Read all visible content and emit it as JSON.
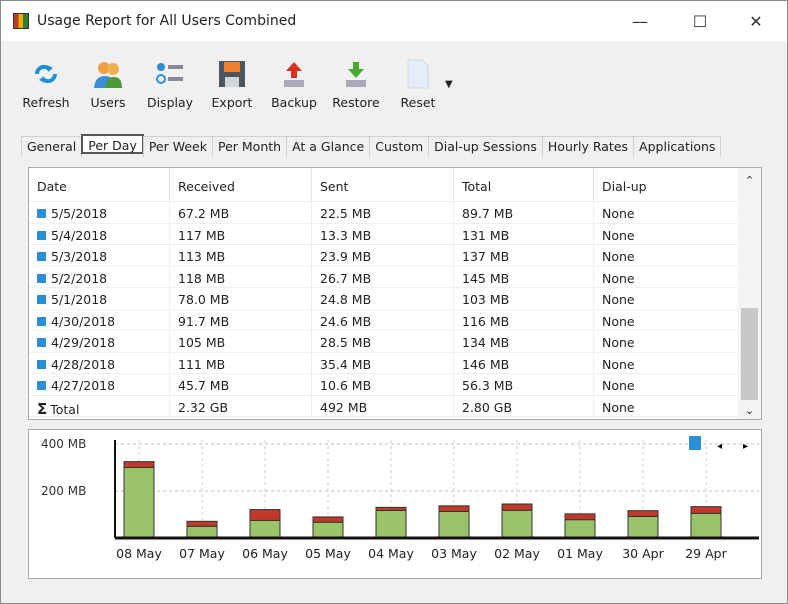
{
  "window": {
    "title": "Usage Report for All Users Combined"
  },
  "toolbar": [
    {
      "label": "Refresh",
      "icon": "refresh-icon"
    },
    {
      "label": "Users",
      "icon": "users-icon"
    },
    {
      "label": "Display",
      "icon": "display-icon"
    },
    {
      "label": "Export",
      "icon": "save-icon"
    },
    {
      "label": "Backup",
      "icon": "backup-icon"
    },
    {
      "label": "Restore",
      "icon": "restore-icon"
    },
    {
      "label": "Reset",
      "icon": "reset-icon"
    }
  ],
  "tabs": [
    "General",
    "Per Day",
    "Per Week",
    "Per Month",
    "At a Glance",
    "Custom",
    "Dial-up Sessions",
    "Hourly Rates",
    "Applications"
  ],
  "active_tab": "Per Day",
  "table": {
    "columns": [
      "Date",
      "Received",
      "Sent",
      "Total",
      "Dial-up"
    ],
    "rows": [
      [
        "5/5/2018",
        "67.2 MB",
        "22.5 MB",
        "89.7 MB",
        "None"
      ],
      [
        "5/4/2018",
        "117 MB",
        "13.3 MB",
        "131 MB",
        "None"
      ],
      [
        "5/3/2018",
        "113 MB",
        "23.9 MB",
        "137 MB",
        "None"
      ],
      [
        "5/2/2018",
        "118 MB",
        "26.7 MB",
        "145 MB",
        "None"
      ],
      [
        "5/1/2018",
        "78.0 MB",
        "24.8 MB",
        "103 MB",
        "None"
      ],
      [
        "4/30/2018",
        "91.7 MB",
        "24.6 MB",
        "116 MB",
        "None"
      ],
      [
        "4/29/2018",
        "105 MB",
        "28.5 MB",
        "134 MB",
        "None"
      ],
      [
        "4/28/2018",
        "111 MB",
        "35.4 MB",
        "146 MB",
        "None"
      ],
      [
        "4/27/2018",
        "45.7 MB",
        "10.6 MB",
        "56.3 MB",
        "None"
      ]
    ],
    "total": [
      "Total",
      "2.32 GB",
      "492 MB",
      "2.80 GB",
      "None"
    ]
  },
  "chart_data": {
    "type": "bar",
    "stacked": true,
    "categories": [
      "08 May",
      "07 May",
      "06 May",
      "05 May",
      "04 May",
      "03 May",
      "02 May",
      "01 May",
      "30 Apr",
      "29 Apr"
    ],
    "series": [
      {
        "name": "Received",
        "color": "#9bc46a",
        "values": [
          300,
          50,
          75,
          67.2,
          117,
          113,
          118,
          78,
          91.7,
          105
        ]
      },
      {
        "name": "Sent",
        "color": "#c0392b",
        "values": [
          25,
          21,
          46,
          22.5,
          13.3,
          23.9,
          26.7,
          24.8,
          24.6,
          28.5
        ]
      }
    ],
    "yticks": [
      {
        "value": 200,
        "label": "200 MB"
      },
      {
        "value": 400,
        "label": "400 MB"
      }
    ],
    "ylim": [
      0,
      400
    ],
    "grid": true
  }
}
